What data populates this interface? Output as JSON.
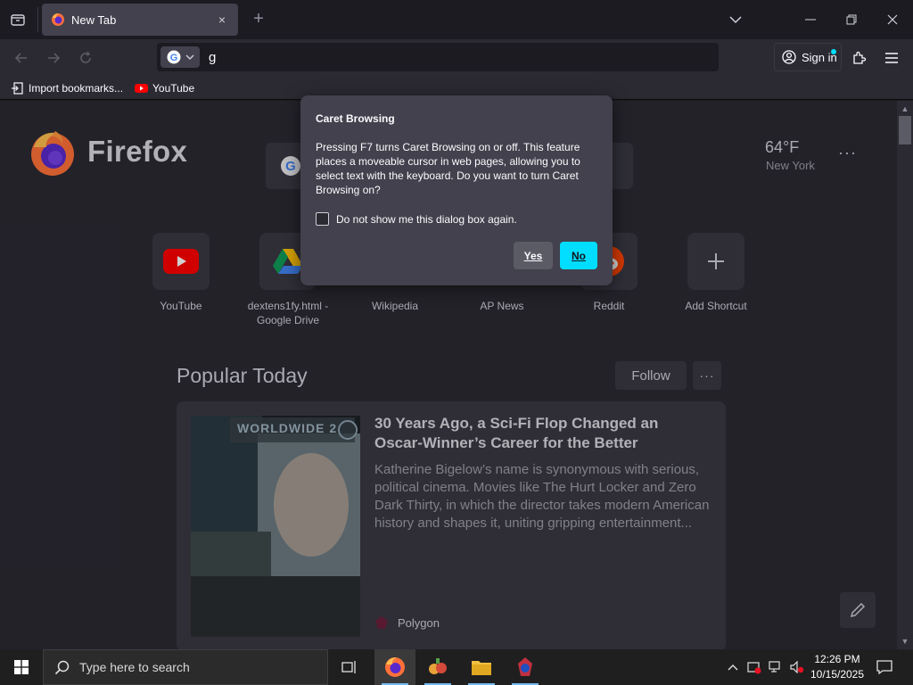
{
  "browser": {
    "tab": {
      "title": "New Tab",
      "favicon": "firefox-icon",
      "close": "×"
    },
    "newtab_label": "+",
    "url_value": "g",
    "signin_label": "Sign in",
    "bookmarks": [
      {
        "label": "Import bookmarks...",
        "icon": "import-icon"
      },
      {
        "label": "YouTube",
        "icon": "youtube-icon"
      }
    ]
  },
  "newtab": {
    "brand": "Firefox",
    "weather": {
      "temp": "64°F",
      "city": "New York",
      "more": "···"
    },
    "shortcuts": [
      {
        "label": "YouTube",
        "icon": "youtube-icon"
      },
      {
        "label": "dextens1fy.html - Google Drive",
        "icon": "google-drive-icon"
      },
      {
        "label": "Wikipedia",
        "icon": "wikipedia-icon"
      },
      {
        "label": "AP News",
        "icon": "ap-news-icon"
      },
      {
        "label": "Reddit",
        "icon": "reddit-icon"
      },
      {
        "label": "Add Shortcut",
        "icon": "plus-icon"
      }
    ],
    "popular": {
      "title": "Popular Today",
      "follow_label": "Follow",
      "more_label": "···",
      "story": {
        "title": "30 Years Ago, a Sci-Fi Flop Changed an Oscar-Winner’s Career for the Better",
        "excerpt": "Katherine Bigelow’s name is synonymous with serious, political cinema. Movies like The Hurt Locker and Zero Dark Thirty, in which the director takes modern American history and shapes it, uniting gripping entertainment...",
        "source": "Polygon",
        "image_caption": "WORLDWIDE 2"
      }
    }
  },
  "dialog": {
    "title": "Caret Browsing",
    "body": "Pressing F7 turns Caret Browsing on or off. This feature places a moveable cursor in web pages, allowing you to select text with the keyboard. Do you want to turn Caret Browsing on?",
    "checkbox_label": "Do not show me this dialog box again.",
    "checkbox_checked": false,
    "yes_label": "Yes",
    "no_label": "No"
  },
  "taskbar": {
    "search_placeholder": "Type here to search",
    "time": "12:26 PM",
    "date": "10/15/2025"
  },
  "colors": {
    "accent": "#00ddff",
    "page_bg": "#2b2a33",
    "chrome_bg": "#1c1b22",
    "dialog_bg": "#42414d"
  }
}
